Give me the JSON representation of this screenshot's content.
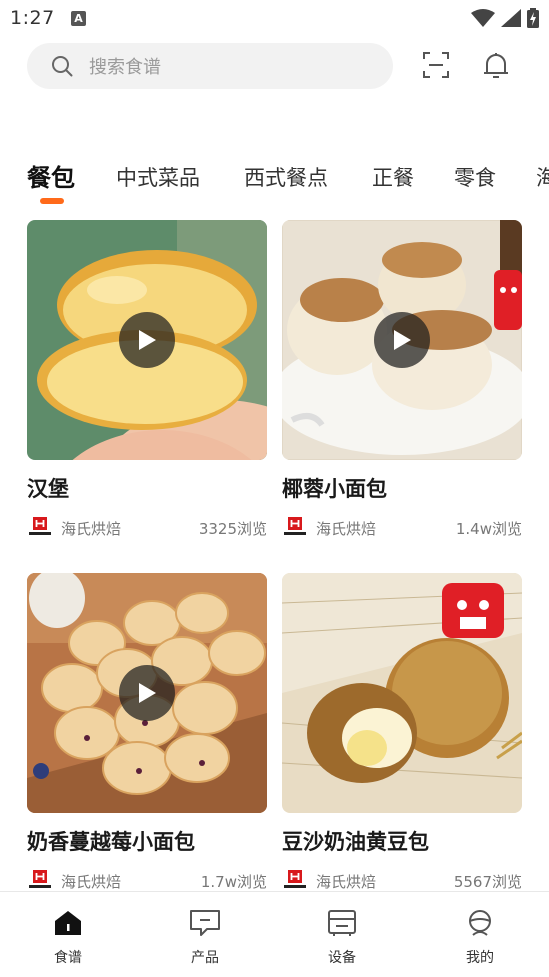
{
  "status_bar": {
    "time": "1:27",
    "notification_badge": "A"
  },
  "search": {
    "placeholder": "搜索食谱"
  },
  "tabs": [
    {
      "label": "餐包",
      "active": true
    },
    {
      "label": "中式菜品",
      "active": false
    },
    {
      "label": "西式餐点",
      "active": false
    },
    {
      "label": "正餐",
      "active": false
    },
    {
      "label": "零食",
      "active": false
    },
    {
      "label": "海",
      "active": false
    }
  ],
  "recipes": [
    {
      "title": "汉堡",
      "brand": "海氏烘焙",
      "views": "3325浏览",
      "has_video": true
    },
    {
      "title": "椰蓉小面包",
      "brand": "海氏烘焙",
      "views": "1.4w浏览",
      "has_video": true
    },
    {
      "title": "奶香蔓越莓小面包",
      "brand": "海氏烘焙",
      "views": "1.7w浏览",
      "has_video": true
    },
    {
      "title": "豆沙奶油黄豆包",
      "brand": "海氏烘焙",
      "views": "5567浏览",
      "has_video": false
    }
  ],
  "bottom_nav": [
    {
      "label": "食谱",
      "icon": "recipe-home-icon",
      "active": true
    },
    {
      "label": "产品",
      "icon": "product-message-icon",
      "active": false
    },
    {
      "label": "设备",
      "icon": "device-icon",
      "active": false
    },
    {
      "label": "我的",
      "icon": "profile-icon",
      "active": false
    }
  ],
  "colors": {
    "accent": "#ff6a1a",
    "brand_red": "#d8191c",
    "search_bg": "#f2f2f2"
  }
}
